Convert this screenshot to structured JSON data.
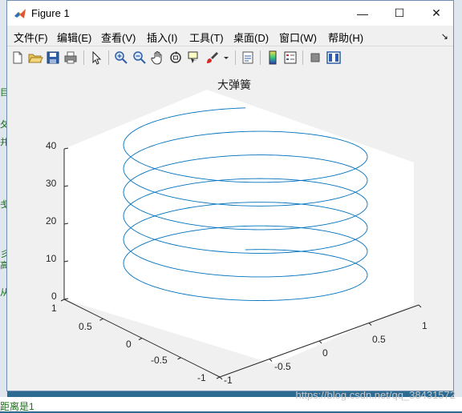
{
  "background": {
    "left_fragments": [
      "目",
      "夂",
      "并",
      "戋",
      "彡",
      "高",
      "从"
    ],
    "bottom_fragment": "距离是1",
    "watermark": "https://blog.csdn.net/qq_38431572"
  },
  "window": {
    "title": "Figure 1",
    "controls": {
      "minimize": "—",
      "maximize": "☐",
      "close": "✕"
    }
  },
  "menubar": {
    "items": [
      "文件(F)",
      "编辑(E)",
      "查看(V)",
      "插入(I)",
      "工具(T)",
      "桌面(D)",
      "窗口(W)",
      "帮助(H)"
    ],
    "overflow": "↘"
  },
  "toolbar": {
    "icons": [
      "new-figure-icon",
      "open-file-icon",
      "save-icon",
      "print-icon",
      "pointer-icon",
      "zoom-in-icon",
      "zoom-out-icon",
      "pan-hand-icon",
      "rotate-3d-icon",
      "data-cursor-icon",
      "brush-icon",
      "link-plot-icon",
      "colorbar-icon",
      "legend-icon",
      "hide-tools-icon",
      "show-tools-icon"
    ],
    "accent": "#0072bd"
  },
  "plot": {
    "title": "大弹簧",
    "z_ticks": [
      "40",
      "30",
      "20",
      "10",
      "0"
    ],
    "x_ticks": [
      "-1",
      "-0.5",
      "0",
      "0.5",
      "1"
    ],
    "y_ticks": [
      "1",
      "0.5",
      "0",
      "-0.5",
      "-1"
    ]
  },
  "chart_data": {
    "type": "line",
    "title": "大弹簧",
    "description_mode": "3d",
    "series": [
      {
        "equation": {
          "x": "sin(t)",
          "y": "cos(t)",
          "z": "t"
        },
        "t_range": [
          0,
          37.7
        ],
        "color": "#0072bd"
      }
    ],
    "xlim": [
      -1,
      1
    ],
    "ylim": [
      -1,
      1
    ],
    "zlim": [
      0,
      40
    ],
    "xticks": [
      -1,
      -0.5,
      0,
      0.5,
      1
    ],
    "yticks": [
      -1,
      -0.5,
      0,
      0.5,
      1
    ],
    "zticks": [
      0,
      10,
      20,
      30,
      40
    ],
    "grid": false
  }
}
